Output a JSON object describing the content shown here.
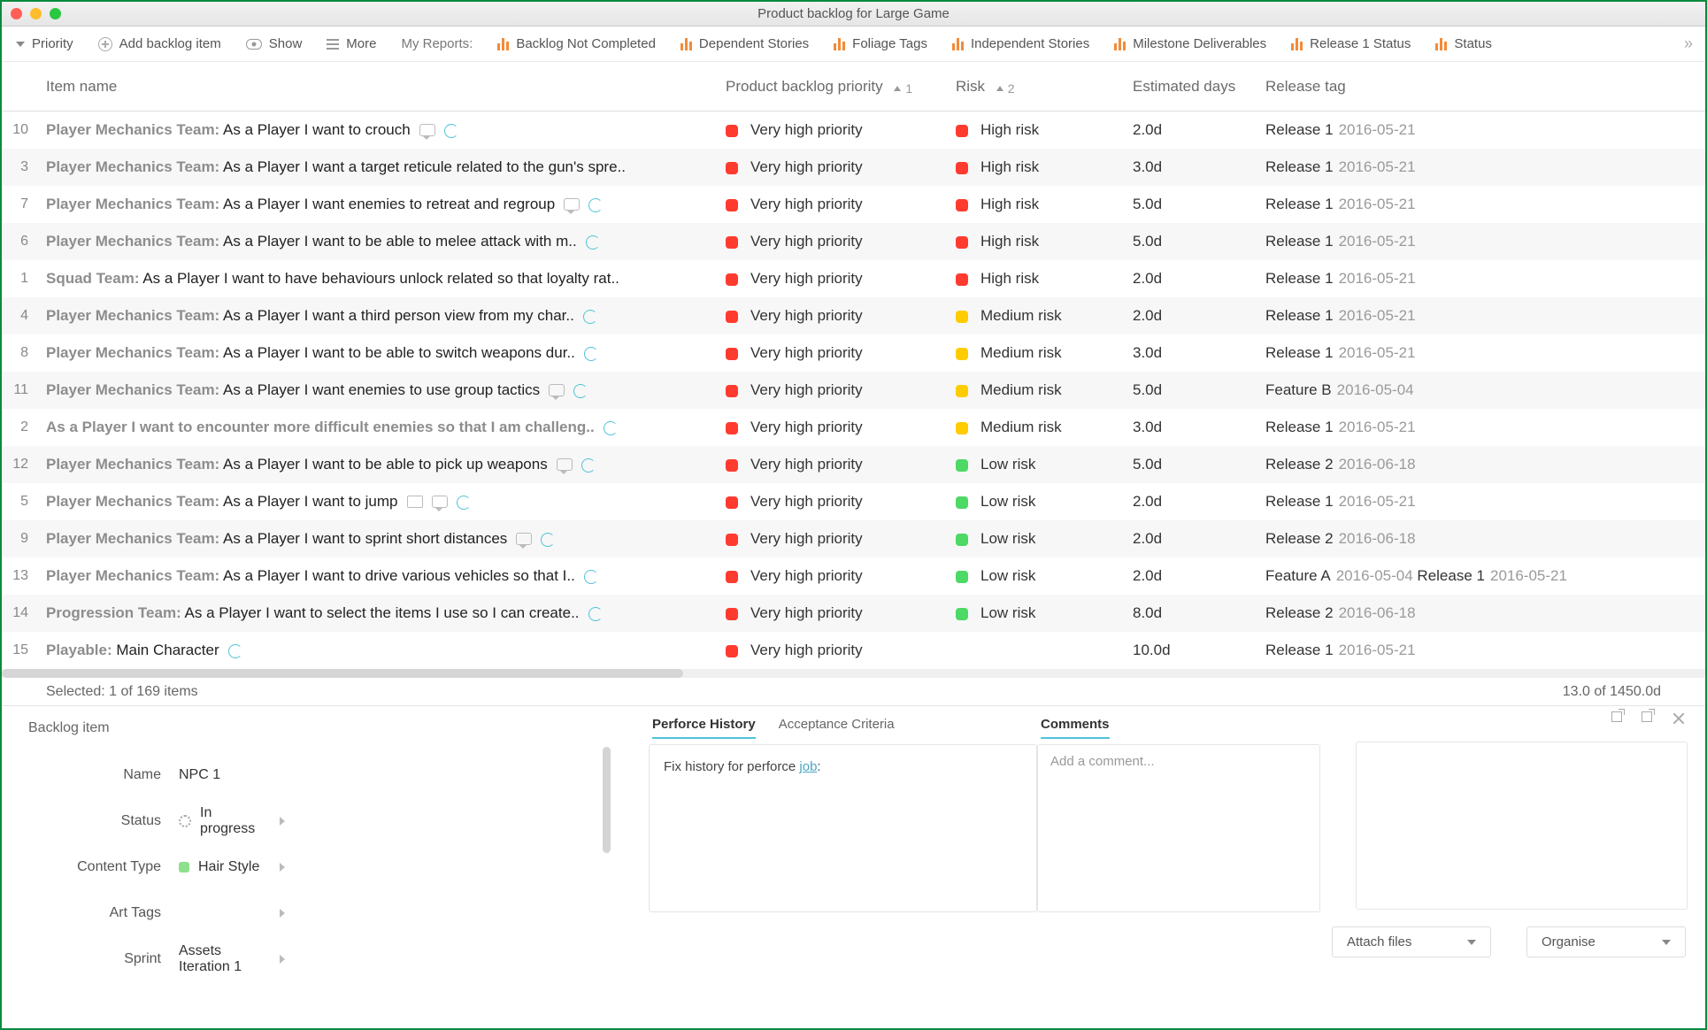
{
  "window": {
    "title": "Product backlog for Large Game"
  },
  "toolbar": {
    "priority": "Priority",
    "add": "Add backlog item",
    "show": "Show",
    "more": "More",
    "myreports": "My Reports:",
    "reports": [
      "Backlog Not Completed",
      "Dependent Stories",
      "Foliage Tags",
      "Independent Stories",
      "Milestone Deliverables",
      "Release 1 Status",
      "Status"
    ]
  },
  "columns": {
    "name": "Item name",
    "priority": "Product backlog priority",
    "risk": "Risk",
    "days": "Estimated days",
    "release": "Release tag",
    "sort1": "1",
    "sort2": "2"
  },
  "rows": [
    {
      "n": "10",
      "team": "Player Mechanics Team:",
      "story": "As a Player I want to crouch",
      "icons": [
        "chat",
        "loop"
      ],
      "pri": "Very high priority",
      "risk": "High risk",
      "rc": "sw-red",
      "days": "2.0d",
      "rel": "Release 1",
      "date": "2016-05-21"
    },
    {
      "n": "3",
      "team": "Player Mechanics Team:",
      "story": "As a Player I want a target reticule related to the gun's spre..",
      "icons": [],
      "pri": "Very high priority",
      "risk": "High risk",
      "rc": "sw-red",
      "days": "3.0d",
      "rel": "Release 1",
      "date": "2016-05-21"
    },
    {
      "n": "7",
      "team": "Player Mechanics Team:",
      "story": "As a Player I want enemies to retreat and regroup",
      "icons": [
        "chat",
        "loop"
      ],
      "pri": "Very high priority",
      "risk": "High risk",
      "rc": "sw-red",
      "days": "5.0d",
      "rel": "Release 1",
      "date": "2016-05-21"
    },
    {
      "n": "6",
      "team": "Player Mechanics Team:",
      "story": "As a Player I want to be able to melee attack with m..",
      "icons": [
        "loop"
      ],
      "pri": "Very high priority",
      "risk": "High risk",
      "rc": "sw-red",
      "days": "5.0d",
      "rel": "Release 1",
      "date": "2016-05-21"
    },
    {
      "n": "1",
      "team": "Squad Team:",
      "story": "As a Player I want to have behaviours unlock related so that loyalty rat..",
      "icons": [],
      "pri": "Very high priority",
      "risk": "High risk",
      "rc": "sw-red",
      "days": "2.0d",
      "rel": "Release 1",
      "date": "2016-05-21"
    },
    {
      "n": "4",
      "team": "Player Mechanics Team:",
      "story": "As a Player I want a third person view from my char..",
      "icons": [
        "loop"
      ],
      "pri": "Very high priority",
      "risk": "Medium risk",
      "rc": "sw-yellow",
      "days": "2.0d",
      "rel": "Release 1",
      "date": "2016-05-21"
    },
    {
      "n": "8",
      "team": "Player Mechanics Team:",
      "story": "As a Player I want to be able to switch weapons dur..",
      "icons": [
        "loop"
      ],
      "pri": "Very high priority",
      "risk": "Medium risk",
      "rc": "sw-yellow",
      "days": "3.0d",
      "rel": "Release 1",
      "date": "2016-05-21"
    },
    {
      "n": "11",
      "team": "Player Mechanics Team:",
      "story": "As a Player I want enemies to use group tactics",
      "icons": [
        "chat",
        "loop"
      ],
      "pri": "Very high priority",
      "risk": "Medium risk",
      "rc": "sw-yellow",
      "days": "5.0d",
      "rel": "Feature B",
      "date": "2016-05-04"
    },
    {
      "n": "2",
      "team": "",
      "story": "As a Player I want to encounter more difficult enemies so that I am challeng..",
      "bold": true,
      "icons": [
        "loop"
      ],
      "pri": "Very high priority",
      "risk": "Medium risk",
      "rc": "sw-yellow",
      "days": "3.0d",
      "rel": "Release 1",
      "date": "2016-05-21"
    },
    {
      "n": "12",
      "team": "Player Mechanics Team:",
      "story": "As a Player I want to be able to pick up weapons",
      "icons": [
        "chat",
        "loop"
      ],
      "pri": "Very high priority",
      "risk": "Low risk",
      "rc": "sw-green",
      "days": "5.0d",
      "rel": "Release 2",
      "date": "2016-06-18"
    },
    {
      "n": "5",
      "team": "Player Mechanics Team:",
      "story": "As a Player I want to jump",
      "icons": [
        "env",
        "chat",
        "loop"
      ],
      "pri": "Very high priority",
      "risk": "Low risk",
      "rc": "sw-green",
      "days": "2.0d",
      "rel": "Release 1",
      "date": "2016-05-21"
    },
    {
      "n": "9",
      "team": "Player Mechanics Team:",
      "story": "As a Player I want to sprint short distances",
      "icons": [
        "chat",
        "loop"
      ],
      "pri": "Very high priority",
      "risk": "Low risk",
      "rc": "sw-green",
      "days": "2.0d",
      "rel": "Release 2",
      "date": "2016-06-18"
    },
    {
      "n": "13",
      "team": "Player Mechanics Team:",
      "story": "As a Player I want to drive various vehicles so that I..",
      "icons": [
        "loop"
      ],
      "pri": "Very high priority",
      "risk": "Low risk",
      "rc": "sw-green",
      "days": "2.0d",
      "rel": "Feature A",
      "date": "2016-05-04",
      "rel2": "Release 1",
      "date2": "2016-05-21"
    },
    {
      "n": "14",
      "team": "Progression Team:",
      "story": "As a Player I want to select the items I use so I can create..",
      "icons": [
        "loop"
      ],
      "pri": "Very high priority",
      "risk": "Low risk",
      "rc": "sw-green",
      "days": "8.0d",
      "rel": "Release 2",
      "date": "2016-06-18"
    },
    {
      "n": "15",
      "team": "Playable:",
      "story": "Main Character",
      "icons": [
        "loop"
      ],
      "pri": "Very high priority",
      "risk": "",
      "rc": "",
      "days": "10.0d",
      "rel": "Release 1",
      "date": "2016-05-21"
    }
  ],
  "status": {
    "selected": "Selected: 1 of 169 items",
    "totals": "13.0 of 1450.0d"
  },
  "detail": {
    "title": "Backlog item",
    "labels": {
      "name": "Name",
      "status": "Status",
      "contenttype": "Content Type",
      "arttags": "Art Tags",
      "sprint": "Sprint"
    },
    "name": "NPC 1",
    "status": "In progress",
    "contenttype": "Hair Style",
    "arttags": "",
    "sprint": "Assets Iteration 1",
    "tabs": {
      "history": "Perforce History",
      "acceptance": "Acceptance Criteria"
    },
    "perforce_prefix": "Fix history for perforce ",
    "perforce_link": "job",
    "perforce_suffix": ":",
    "comments_head": "Comments",
    "comment_placeholder": "Add a comment...",
    "attach": "Attach files",
    "organise": "Organise"
  }
}
